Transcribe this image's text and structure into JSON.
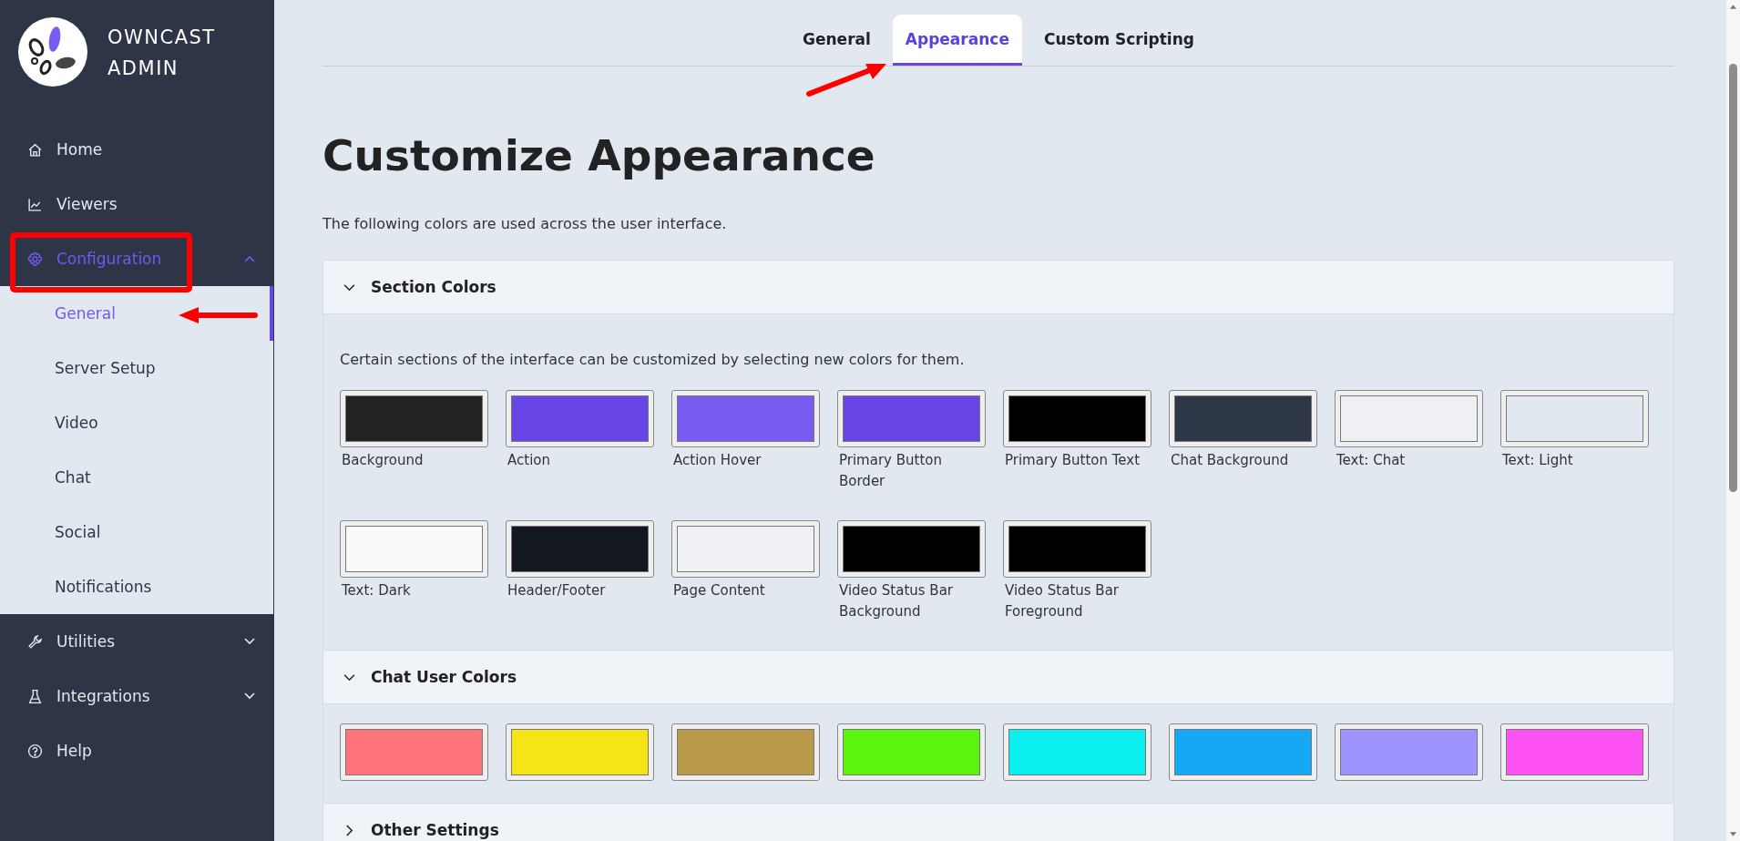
{
  "sidebar": {
    "app_title": "OWNCAST ADMIN",
    "nav": [
      {
        "label": "Home",
        "selected": false
      },
      {
        "label": "Viewers",
        "selected": false
      },
      {
        "label": "Configuration",
        "selected": true,
        "expanded": true,
        "children": [
          {
            "label": "General",
            "selected": true
          },
          {
            "label": "Server Setup",
            "selected": false
          },
          {
            "label": "Video",
            "selected": false
          },
          {
            "label": "Chat",
            "selected": false
          },
          {
            "label": "Social",
            "selected": false
          },
          {
            "label": "Notifications",
            "selected": false
          }
        ]
      },
      {
        "label": "Utilities",
        "selected": false,
        "expanded": false
      },
      {
        "label": "Integrations",
        "selected": false,
        "expanded": false
      },
      {
        "label": "Help",
        "selected": false
      }
    ]
  },
  "tabs": [
    {
      "label": "General",
      "selected": false
    },
    {
      "label": "Appearance",
      "selected": true
    },
    {
      "label": "Custom Scripting",
      "selected": false
    }
  ],
  "page": {
    "title": "Customize Appearance",
    "description": "The following colors are used across the user interface."
  },
  "panels": [
    {
      "title": "Section Colors",
      "expanded": true,
      "description": "Certain sections of the interface can be customized by selecting new colors for them.",
      "swatches": [
        {
          "label": "Background",
          "color": "#222222"
        },
        {
          "label": "Action",
          "color": "#6745e7"
        },
        {
          "label": "Action Hover",
          "color": "#7b5cf2"
        },
        {
          "label": "Primary Button Border",
          "color": "#6745e7"
        },
        {
          "label": "Primary Button Text",
          "color": "#000000"
        },
        {
          "label": "Chat Background",
          "color": "#2d3748"
        },
        {
          "label": "Text: Chat",
          "color": "#eef0f4"
        },
        {
          "label": "Text: Light",
          "color": "#e2e8f0"
        },
        {
          "label": "Text: Dark",
          "color": "#fafafa"
        },
        {
          "label": "Header/Footer",
          "color": "#121720"
        },
        {
          "label": "Page Content",
          "color": "#eff1f5"
        },
        {
          "label": "Video Status Bar Background",
          "color": "#000000"
        },
        {
          "label": "Video Status Bar Foreground",
          "color": "#000000"
        }
      ]
    },
    {
      "title": "Chat User Colors",
      "expanded": true,
      "swatches": [
        {
          "color": "#ff737b"
        },
        {
          "color": "#f5e516"
        },
        {
          "color": "#b99a48"
        },
        {
          "color": "#5af50e"
        },
        {
          "color": "#0af0f0"
        },
        {
          "color": "#16a7f5"
        },
        {
          "color": "#9d94ff"
        },
        {
          "color": "#ff52f5"
        }
      ]
    },
    {
      "title": "Other Settings",
      "expanded": false
    }
  ]
}
